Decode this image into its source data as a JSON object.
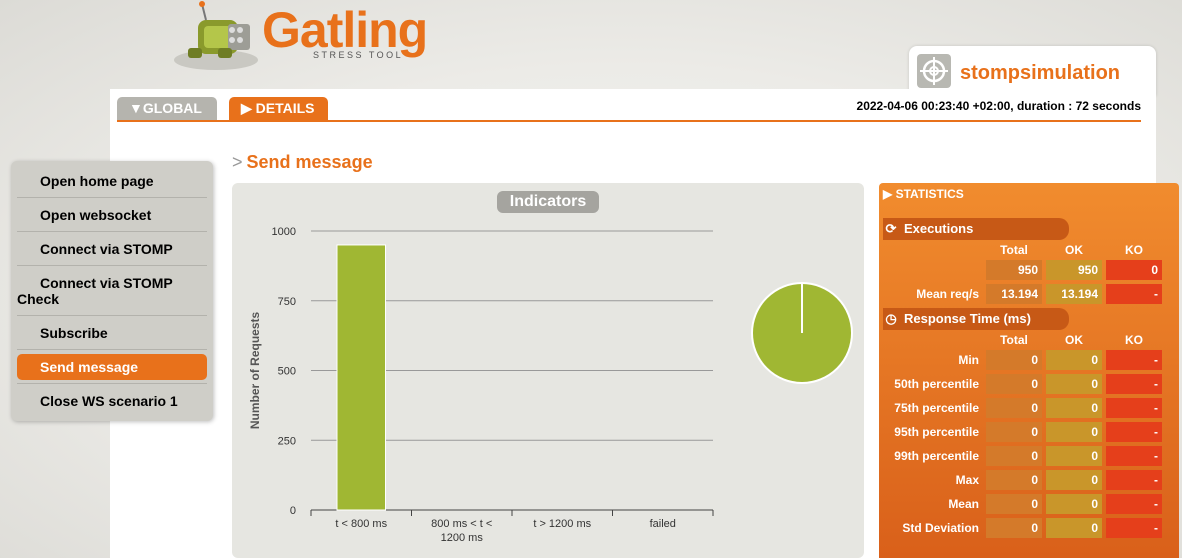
{
  "header": {
    "logo_title": "Gatling",
    "logo_subtitle": "STRESS TOOL",
    "simulation_name": "stompsimulation",
    "run_info": "2022-04-06 00:23:40 +02:00, duration : 72 seconds"
  },
  "tabs": {
    "global": "GLOBAL",
    "details": "DETAILS"
  },
  "menu": {
    "items": [
      {
        "label": "Open home page"
      },
      {
        "label": "Open websocket"
      },
      {
        "label": "Connect via STOMP"
      },
      {
        "label": "Connect via STOMP Check"
      },
      {
        "label": "Subscribe"
      },
      {
        "label": "Send message",
        "active": true
      },
      {
        "label": "Close WS scenario 1"
      }
    ]
  },
  "request_title": "Send message",
  "chart_data": {
    "type": "bar",
    "title": "Indicators",
    "ylabel": "Number of Requests",
    "ylim": [
      0,
      1000
    ],
    "yticks": [
      0,
      250,
      500,
      750,
      1000
    ],
    "categories": [
      "t < 800 ms",
      "800 ms < t < 1200 ms",
      "t > 1200 ms",
      "failed"
    ],
    "values": [
      950,
      0,
      0,
      0
    ],
    "pie": [
      {
        "label": "t < 800 ms",
        "value": 950
      }
    ],
    "colors": {
      "bar": "#a0b733",
      "pie": "#a0b733"
    }
  },
  "stats": {
    "title": "STATISTICS",
    "executions": {
      "heading": "Executions",
      "columns": [
        "Total",
        "OK",
        "KO"
      ],
      "rows": [
        {
          "label": "",
          "total": "950",
          "ok": "950",
          "ko": "0"
        },
        {
          "label": "Mean req/s",
          "total": "13.194",
          "ok": "13.194",
          "ko": "-"
        }
      ]
    },
    "response_time": {
      "heading": "Response Time (ms)",
      "columns": [
        "Total",
        "OK",
        "KO"
      ],
      "rows": [
        {
          "label": "Min",
          "total": "0",
          "ok": "0",
          "ko": "-"
        },
        {
          "label": "50th percentile",
          "total": "0",
          "ok": "0",
          "ko": "-"
        },
        {
          "label": "75th percentile",
          "total": "0",
          "ok": "0",
          "ko": "-"
        },
        {
          "label": "95th percentile",
          "total": "0",
          "ok": "0",
          "ko": "-"
        },
        {
          "label": "99th percentile",
          "total": "0",
          "ok": "0",
          "ko": "-"
        },
        {
          "label": "Max",
          "total": "0",
          "ok": "0",
          "ko": "-"
        },
        {
          "label": "Mean",
          "total": "0",
          "ok": "0",
          "ko": "-"
        },
        {
          "label": "Std Deviation",
          "total": "0",
          "ok": "0",
          "ko": "-"
        }
      ]
    }
  }
}
